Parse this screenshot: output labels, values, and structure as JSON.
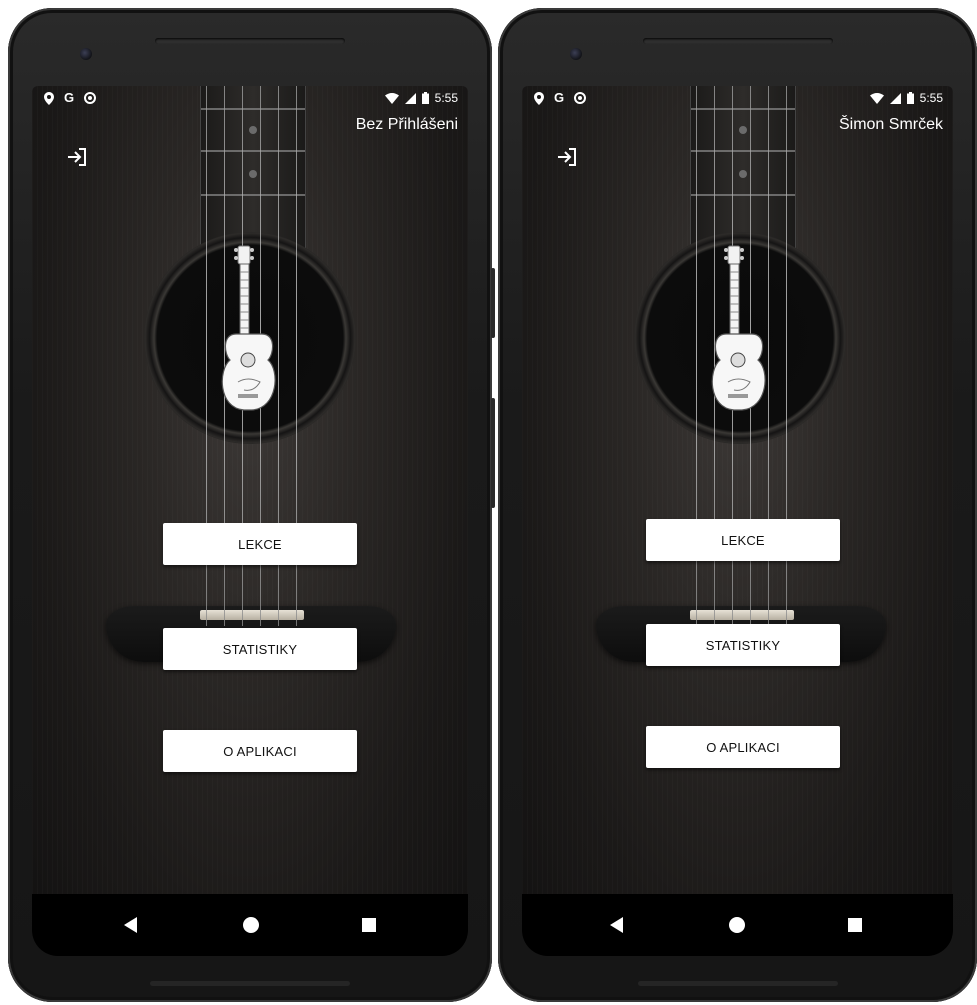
{
  "screens": [
    {
      "status": {
        "icons_left": [
          "location-icon",
          "google-icon",
          "sync-icon"
        ],
        "time": "5:55"
      },
      "user_label": "Bez Přihlášeni",
      "menu": {
        "lekce": "LEKCE",
        "statistiky": "STATISTIKY",
        "o_aplikaci": "O APLIKACI"
      }
    },
    {
      "status": {
        "icons_left": [
          "location-icon",
          "google-icon",
          "sync-icon"
        ],
        "time": "5:55"
      },
      "user_label": "Šimon Smrček",
      "menu": {
        "lekce": "LEKCE",
        "statistiky": "STATISTIKY",
        "o_aplikaci": "O APLIKACI"
      }
    }
  ],
  "theme": {
    "background": "#1e1c1b",
    "button_bg": "#ffffff",
    "button_text": "#111111",
    "text": "#ffffff"
  }
}
